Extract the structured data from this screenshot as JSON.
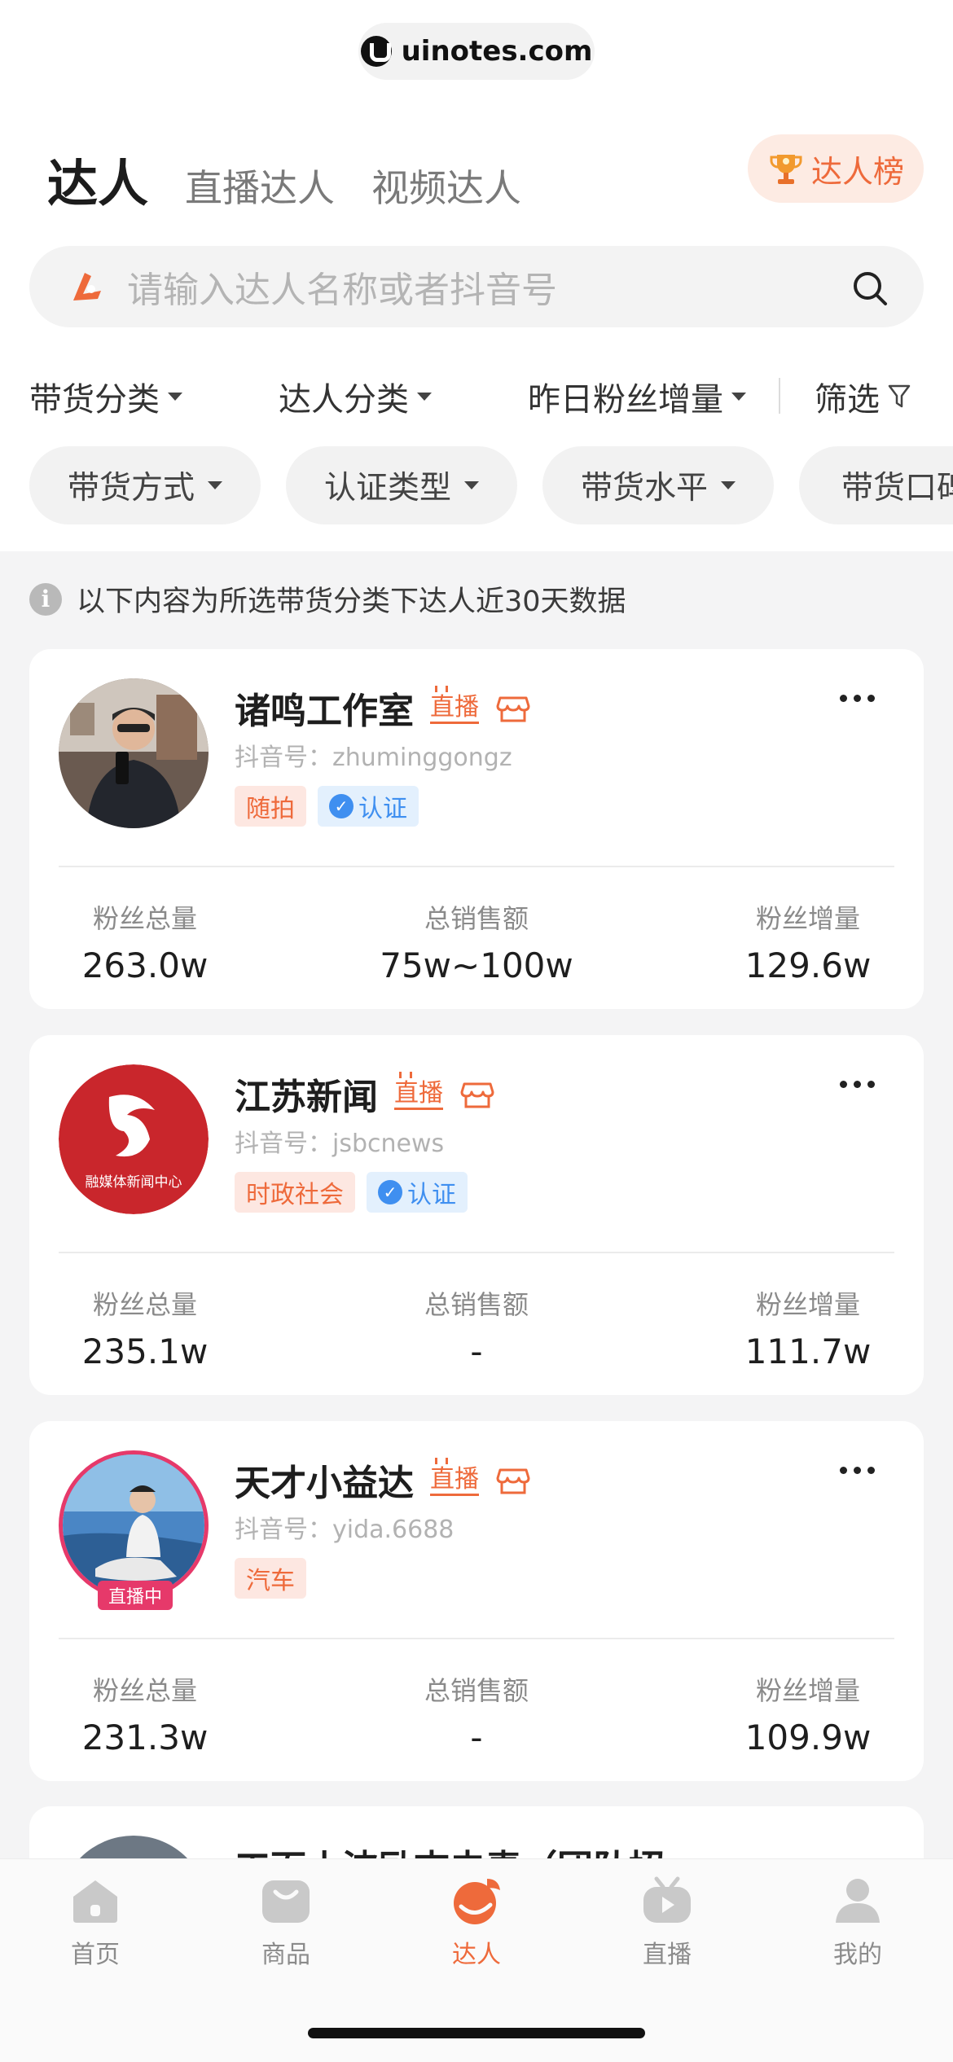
{
  "site": {
    "url": "uinotes.com"
  },
  "header": {
    "tabs": [
      {
        "label": "达人",
        "active": true
      },
      {
        "label": "直播达人",
        "active": false
      },
      {
        "label": "视频达人",
        "active": false
      }
    ],
    "rank_button": "达人榜"
  },
  "search": {
    "placeholder": "请输入达人名称或者抖音号"
  },
  "filters": {
    "dropdowns": [
      "带货分类",
      "达人分类",
      "昨日粉丝增量"
    ],
    "filter_label": "筛选",
    "chips": [
      "带货方式",
      "认证类型",
      "带货水平",
      "带货口碑"
    ]
  },
  "notice": {
    "text": "以下内容为所选带货分类下达人近30天数据"
  },
  "cards": [
    {
      "name": "诸鸣工作室",
      "live_tag": "直播",
      "douyin_id": "抖音号：zhuminggongz",
      "category": "随拍",
      "certified": "认证",
      "stats": [
        {
          "label": "粉丝总量",
          "value": "263.0w"
        },
        {
          "label": "总销售额",
          "value": "75w~100w"
        },
        {
          "label": "粉丝增量",
          "value": "129.6w"
        }
      ]
    },
    {
      "name": "江苏新闻",
      "live_tag": "直播",
      "douyin_id": "抖音号：jsbcnews",
      "avatar_text": "融媒体新闻中心",
      "category": "时政社会",
      "certified": "认证",
      "stats": [
        {
          "label": "粉丝总量",
          "value": "235.1w"
        },
        {
          "label": "总销售额",
          "value": "-"
        },
        {
          "label": "粉丝增量",
          "value": "111.7w"
        }
      ]
    },
    {
      "name": "天才小益达",
      "live_tag": "直播",
      "douyin_id": "抖音号：yida.6688",
      "live_now": "直播中",
      "category": "汽车",
      "stats": [
        {
          "label": "粉丝总量",
          "value": "231.3w"
        },
        {
          "label": "总销售额",
          "value": "-"
        },
        {
          "label": "粉丝增量",
          "value": "109.9w"
        }
      ]
    }
  ],
  "partial_card": {
    "name": "工面小波励志去毒（团队招"
  },
  "bottom_nav": [
    {
      "label": "首页",
      "icon": "home-icon",
      "active": false
    },
    {
      "label": "商品",
      "icon": "bag-icon",
      "active": false
    },
    {
      "label": "达人",
      "icon": "influencer-icon",
      "active": true
    },
    {
      "label": "直播",
      "icon": "tv-play-icon",
      "active": false
    },
    {
      "label": "我的",
      "icon": "user-icon",
      "active": false
    }
  ],
  "colors": {
    "accent": "#ee6a3b",
    "cert": "#3f8ff0",
    "live": "#e6396a",
    "background": "#f4f4f5"
  }
}
